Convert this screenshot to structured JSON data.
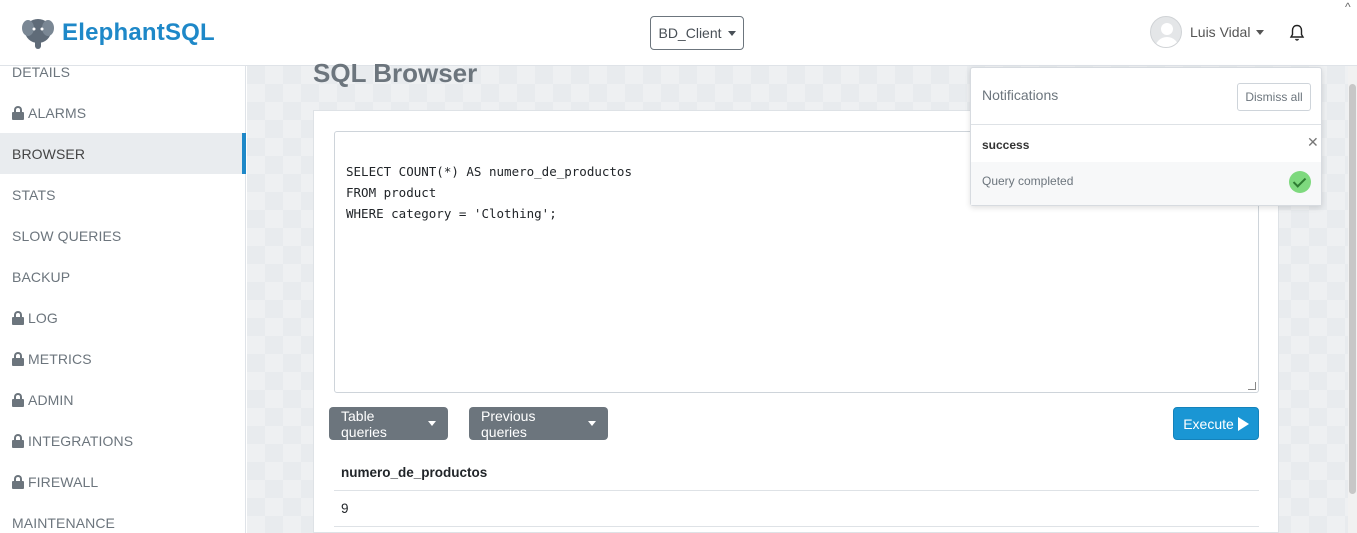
{
  "header": {
    "brand": "ElephantSQL",
    "instance_selector": "BD_Client",
    "user_name": "Luis Vidal"
  },
  "sidebar": {
    "items": [
      {
        "label": "DETAILS",
        "locked": false,
        "active": false
      },
      {
        "label": "ALARMS",
        "locked": true,
        "active": false
      },
      {
        "label": "BROWSER",
        "locked": false,
        "active": true
      },
      {
        "label": "STATS",
        "locked": false,
        "active": false
      },
      {
        "label": "SLOW QUERIES",
        "locked": false,
        "active": false
      },
      {
        "label": "BACKUP",
        "locked": false,
        "active": false
      },
      {
        "label": "LOG",
        "locked": true,
        "active": false
      },
      {
        "label": "METRICS",
        "locked": true,
        "active": false
      },
      {
        "label": "ADMIN",
        "locked": true,
        "active": false
      },
      {
        "label": "INTEGRATIONS",
        "locked": true,
        "active": false
      },
      {
        "label": "FIREWALL",
        "locked": true,
        "active": false
      },
      {
        "label": "MAINTENANCE",
        "locked": false,
        "active": false
      }
    ]
  },
  "main": {
    "title": "SQL Browser",
    "query_lines": [
      "SELECT COUNT(*) AS numero_de_productos",
      "FROM product",
      "WHERE category = 'Clothing';"
    ],
    "buttons": {
      "table_queries": "Table queries",
      "previous_queries": "Previous queries",
      "execute": "Execute"
    },
    "result": {
      "columns": [
        "numero_de_productos"
      ],
      "rows": [
        [
          "9"
        ]
      ]
    }
  },
  "notifications": {
    "title": "Notifications",
    "dismiss_all": "Dismiss all",
    "items": [
      {
        "type": "success",
        "message": "Query completed"
      }
    ]
  },
  "colors": {
    "brand": "#1e88c8",
    "execute": "#1a96d4",
    "secondary_button": "#6c757d",
    "success": "#7ed97e"
  }
}
